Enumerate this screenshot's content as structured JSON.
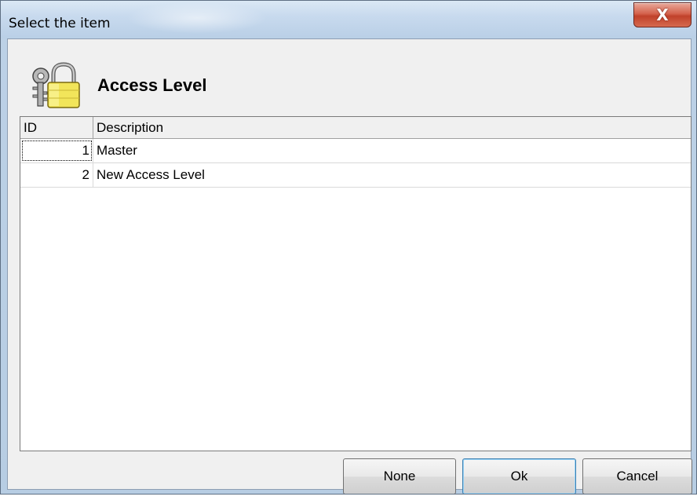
{
  "window": {
    "title": "Select the item",
    "close_label": "X"
  },
  "header": {
    "icon": "lock-with-keys-icon",
    "title": "Access Level"
  },
  "grid": {
    "columns": [
      "ID",
      "Description"
    ],
    "rows": [
      {
        "id": "1",
        "description": "Master"
      },
      {
        "id": "2",
        "description": "New Access Level"
      }
    ]
  },
  "buttons": {
    "none": "None",
    "ok": "Ok",
    "cancel": "Cancel"
  },
  "colors": {
    "title_bar": "#c8daee",
    "close_button": "#c0412a",
    "dialog_background": "#f0f0f0",
    "default_button_border": "#3c7fb1"
  }
}
